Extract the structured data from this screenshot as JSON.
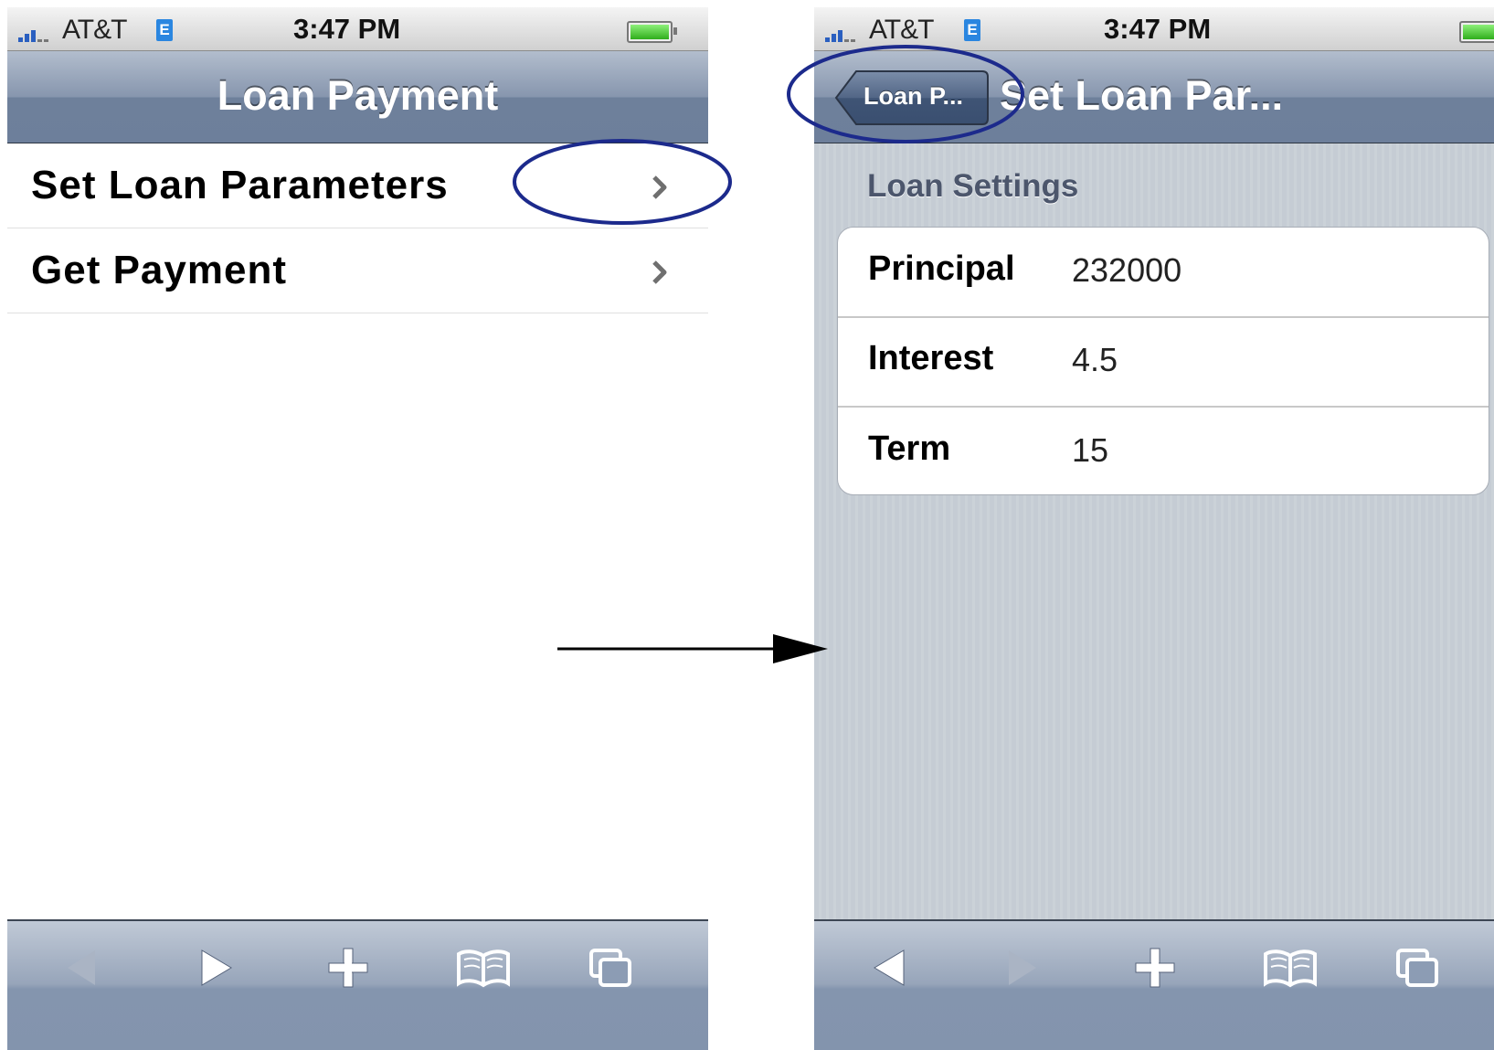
{
  "left_screen": {
    "status": {
      "carrier": "AT&T",
      "network": "E",
      "time": "3:47 PM"
    },
    "nav": {
      "title": "Loan Payment"
    },
    "rows": [
      {
        "label": "Set Loan Parameters"
      },
      {
        "label": "Get Payment"
      }
    ],
    "toolbar": [
      "back-arrow-icon",
      "forward-arrow-icon",
      "add-bookmark-icon",
      "bookmarks-icon",
      "pages-icon"
    ]
  },
  "right_screen": {
    "status": {
      "carrier": "AT&T",
      "network": "E",
      "time": "3:47 PM"
    },
    "nav": {
      "back_label": "Loan P...",
      "title": "Set Loan Par..."
    },
    "group_header": "Loan Settings",
    "settings": [
      {
        "label": "Principal",
        "value": "232000"
      },
      {
        "label": "Interest",
        "value": "4.5"
      },
      {
        "label": "Term",
        "value": "15"
      }
    ],
    "toolbar": [
      "back-arrow-icon",
      "forward-arrow-icon",
      "add-bookmark-icon",
      "bookmarks-icon",
      "pages-icon"
    ]
  },
  "colors": {
    "nav_bar": "#6d7f9b",
    "annotation_circle": "#1c2a8c",
    "group_header_text": "#4c566c",
    "signal_bars": "#2a5fc0",
    "battery": "#2fae1c"
  }
}
